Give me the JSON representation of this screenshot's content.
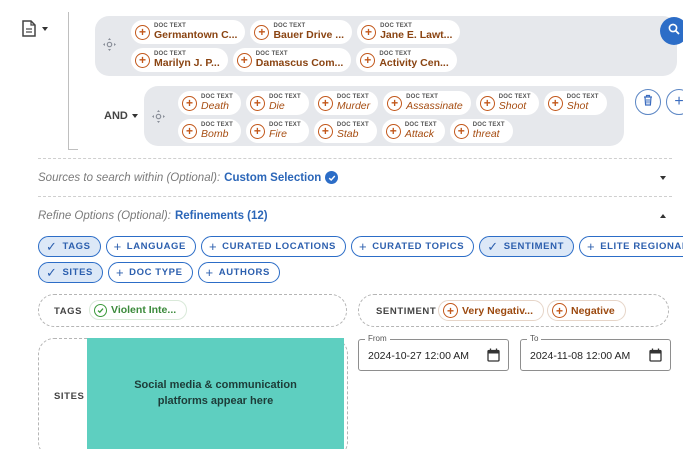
{
  "header": {
    "doc_icon": "document-icon"
  },
  "query_groups": [
    {
      "chips": [
        {
          "tag": "DOC TEXT",
          "value": "Germantown C..."
        },
        {
          "tag": "DOC TEXT",
          "value": "Bauer Drive ..."
        },
        {
          "tag": "DOC TEXT",
          "value": "Jane E. Lawt..."
        },
        {
          "tag": "DOC TEXT",
          "value": "Marilyn J. P..."
        },
        {
          "tag": "DOC TEXT",
          "value": "Damascus Com..."
        },
        {
          "tag": "DOC TEXT",
          "value": "Activity Cen..."
        }
      ]
    },
    {
      "operator": "AND",
      "chips": [
        {
          "tag": "DOC TEXT",
          "value": "Death"
        },
        {
          "tag": "DOC TEXT",
          "value": "Die"
        },
        {
          "tag": "DOC TEXT",
          "value": "Murder"
        },
        {
          "tag": "DOC TEXT",
          "value": "Assassinate"
        },
        {
          "tag": "DOC TEXT",
          "value": "Shoot"
        },
        {
          "tag": "DOC TEXT",
          "value": "Shot"
        },
        {
          "tag": "DOC TEXT",
          "value": "Bomb"
        },
        {
          "tag": "DOC TEXT",
          "value": "Fire"
        },
        {
          "tag": "DOC TEXT",
          "value": "Stab"
        },
        {
          "tag": "DOC TEXT",
          "value": "Attack"
        },
        {
          "tag": "DOC TEXT",
          "value": "threat"
        }
      ]
    }
  ],
  "sources": {
    "label": "Sources to search within (Optional):",
    "value": "Custom Selection"
  },
  "refine": {
    "label": "Refine Options (Optional):",
    "value": "Refinements (12)"
  },
  "filters": [
    {
      "label": "TAGS",
      "selected": true
    },
    {
      "label": "LANGUAGE",
      "selected": false
    },
    {
      "label": "CURATED LOCATIONS",
      "selected": false
    },
    {
      "label": "CURATED TOPICS",
      "selected": false
    },
    {
      "label": "SENTIMENT",
      "selected": true
    },
    {
      "label": "ELITE REGIONAL",
      "selected": false
    },
    {
      "label": "SITES",
      "selected": true
    },
    {
      "label": "DOC TYPE",
      "selected": false
    },
    {
      "label": "AUTHORS",
      "selected": false
    }
  ],
  "tags_box": {
    "label": "TAGS",
    "chip": "Violent Inte..."
  },
  "sentiment_box": {
    "label": "SENTIMENT",
    "chips": [
      "Very Negativ...",
      "Negative"
    ]
  },
  "sites_box": {
    "label": "SITES",
    "placeholder": "Social media & communication platforms appear here"
  },
  "date_range": {
    "from_label": "From",
    "from_value": "2024-10-27 12:00 AM",
    "to_label": "To",
    "to_value": "2024-11-08 12:00 AM"
  },
  "colors": {
    "accent": "#2c6dc7",
    "chip_orange": "#c2571a",
    "teal_placeholder": "#5ecfc0",
    "group_bg": "#e6e8ec"
  }
}
